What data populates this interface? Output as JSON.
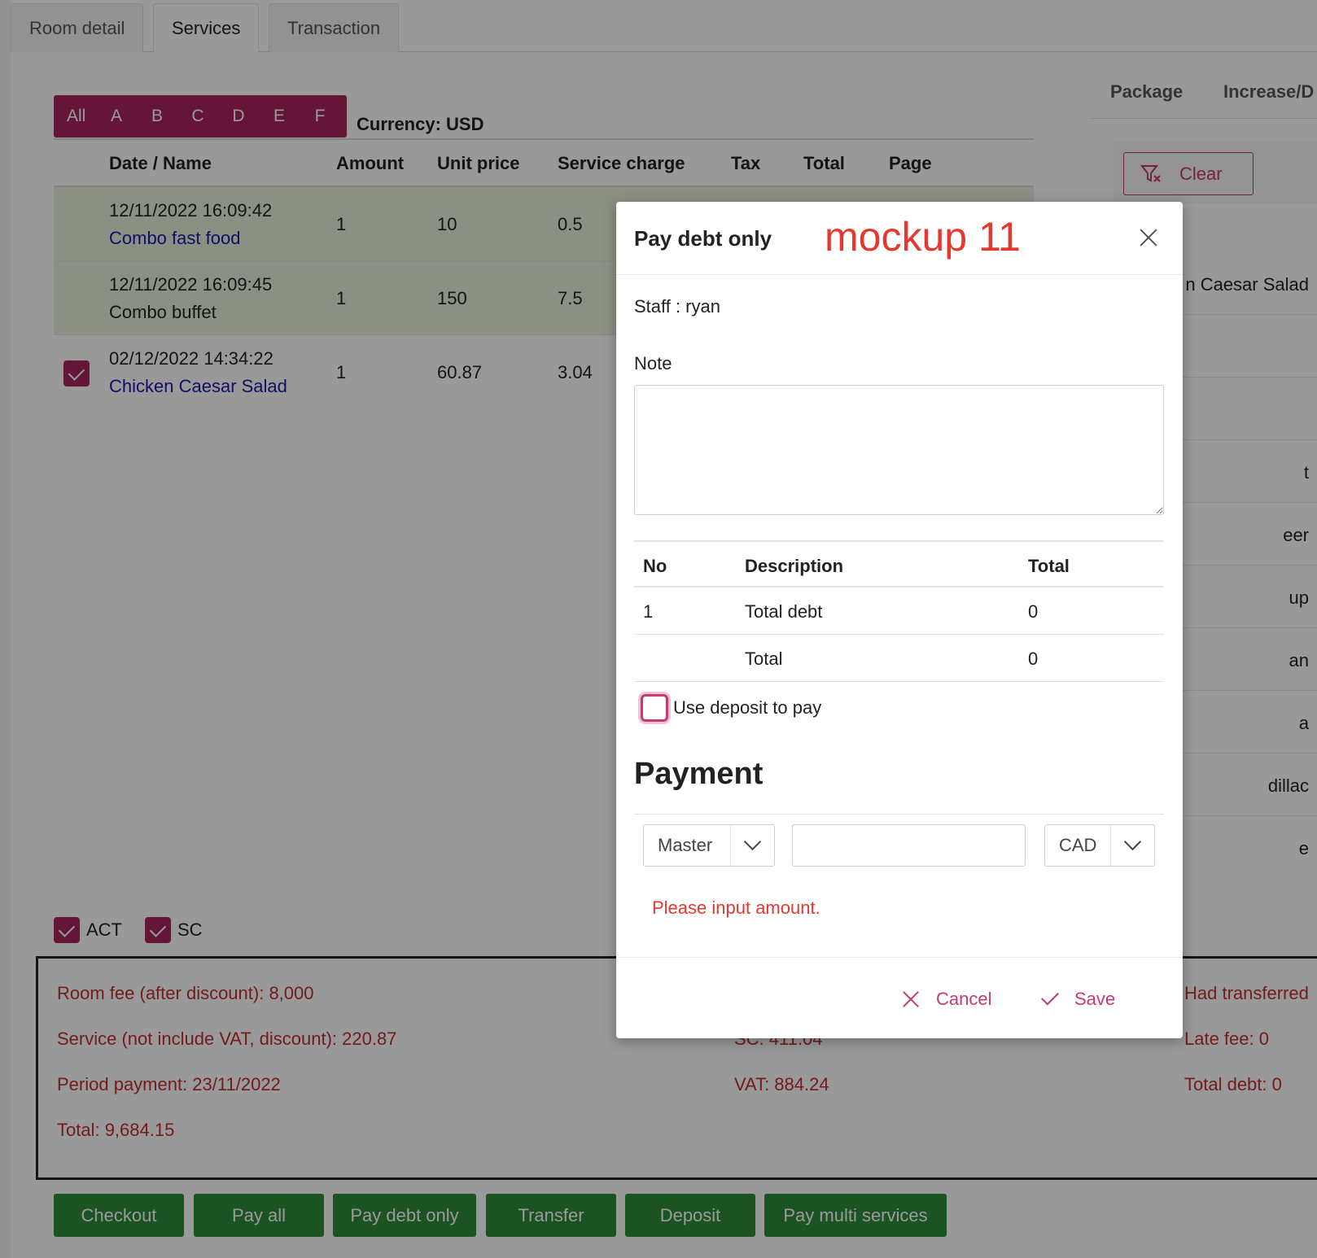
{
  "tabs": [
    {
      "label": "Room detail"
    },
    {
      "label": "Services"
    },
    {
      "label": "Transaction"
    }
  ],
  "filter": {
    "letters": [
      "All",
      "A",
      "B",
      "C",
      "D",
      "E",
      "F"
    ],
    "currency": "Currency: USD"
  },
  "services_table": {
    "headers": [
      "Date / Name",
      "Amount",
      "Unit price",
      "Service charge",
      "Tax",
      "Total",
      "Page"
    ],
    "rows": [
      {
        "date": "12/11/2022 16:09:42",
        "name": "Combo fast food",
        "amount": "1",
        "unit_price": "10",
        "service_charge": "0.5",
        "checked": false
      },
      {
        "date": "12/11/2022 16:09:45",
        "name": "Combo buffet",
        "amount": "1",
        "unit_price": "150",
        "service_charge": "7.5",
        "checked": false
      },
      {
        "date": "02/12/2022 14:34:22",
        "name": "Chicken Caesar Salad",
        "amount": "1",
        "unit_price": "60.87",
        "service_charge": "3.04",
        "checked": true
      }
    ]
  },
  "right_panel": {
    "tabs": [
      "Package",
      "Increase/D"
    ],
    "clear_label": "Clear",
    "items": [
      "n Caesar Salad",
      "",
      "",
      "t",
      "eer",
      "up",
      "an",
      "a",
      "dillac",
      "e"
    ]
  },
  "flags": {
    "act_label": "ACT",
    "sc_label": "SC"
  },
  "summary": {
    "room_fee": "Room fee (after discount): 8,000",
    "service": "Service (not include VAT, discount): 220.87",
    "period_payment": "Period payment: 23/11/2022",
    "total": "Total: 9,684.15",
    "sc": "SC: 411.04",
    "vat": "VAT: 884.24",
    "had_transferred": "Had transferred",
    "late_fee": "Late fee: 0",
    "total_debt": "Total debt: 0"
  },
  "actions": {
    "checkout": "Checkout",
    "pay_all": "Pay all",
    "pay_debt_only": "Pay debt only",
    "transfer": "Transfer",
    "deposit": "Deposit",
    "pay_multi": "Pay multi services"
  },
  "modal": {
    "title": "Pay debt only",
    "mockup_label": "mockup 11",
    "staff": "Staff : ryan",
    "note_label": "Note",
    "note_value": "",
    "table_headers": {
      "no": "No",
      "description": "Description",
      "total": "Total"
    },
    "table_rows": [
      {
        "no": "1",
        "description": "Total debt",
        "total": "0"
      },
      {
        "no": "",
        "description": "Total",
        "total": "0"
      }
    ],
    "use_deposit_label": "Use deposit to pay",
    "use_deposit_checked": false,
    "payment_title": "Payment",
    "payment_method": "Master",
    "amount_value": "",
    "currency": "CAD",
    "error": "Please input amount.",
    "cancel_label": "Cancel",
    "save_label": "Save"
  },
  "colors": {
    "brand": "#a8265e",
    "accent": "#c43b73",
    "error": "#e4392f",
    "action_button": "#2f8a3a",
    "highlight_row": "#e6f2dd",
    "link": "#1a1aa8"
  }
}
